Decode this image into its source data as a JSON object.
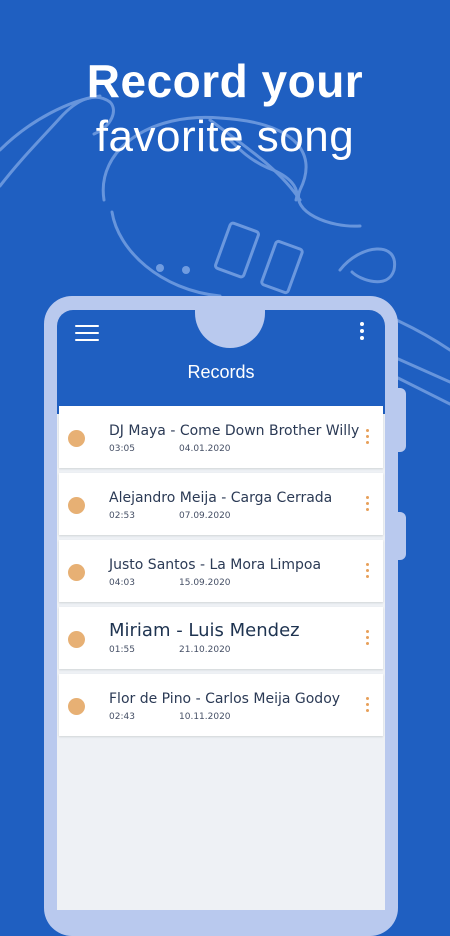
{
  "colors": {
    "background": "#1f5fc1",
    "phone_frame": "#b9c9ee",
    "screen_bg": "#eef1f5",
    "record_dot": "#e7b074",
    "item_menu": "#e7a059"
  },
  "headline": {
    "line1": "Record your",
    "line2": "favorite song"
  },
  "appbar": {
    "title": "Records",
    "menu_icon": "hamburger-menu-icon",
    "more_icon": "more-vert-icon"
  },
  "records": [
    {
      "title": "DJ Maya - Come Down Brother Willy",
      "duration": "03:05",
      "date": "04.01.2020"
    },
    {
      "title": "Alejandro Meija - Carga Cerrada",
      "duration": "02:53",
      "date": "07.09.2020"
    },
    {
      "title": "Justo Santos - La Mora Limpoa",
      "duration": "04:03",
      "date": "15.09.2020"
    },
    {
      "title": "Miriam - Luis Mendez",
      "duration": "01:55",
      "date": "21.10.2020"
    },
    {
      "title": "Flor de Pino - Carlos Meija Godoy",
      "duration": "02:43",
      "date": "10.11.2020"
    }
  ]
}
